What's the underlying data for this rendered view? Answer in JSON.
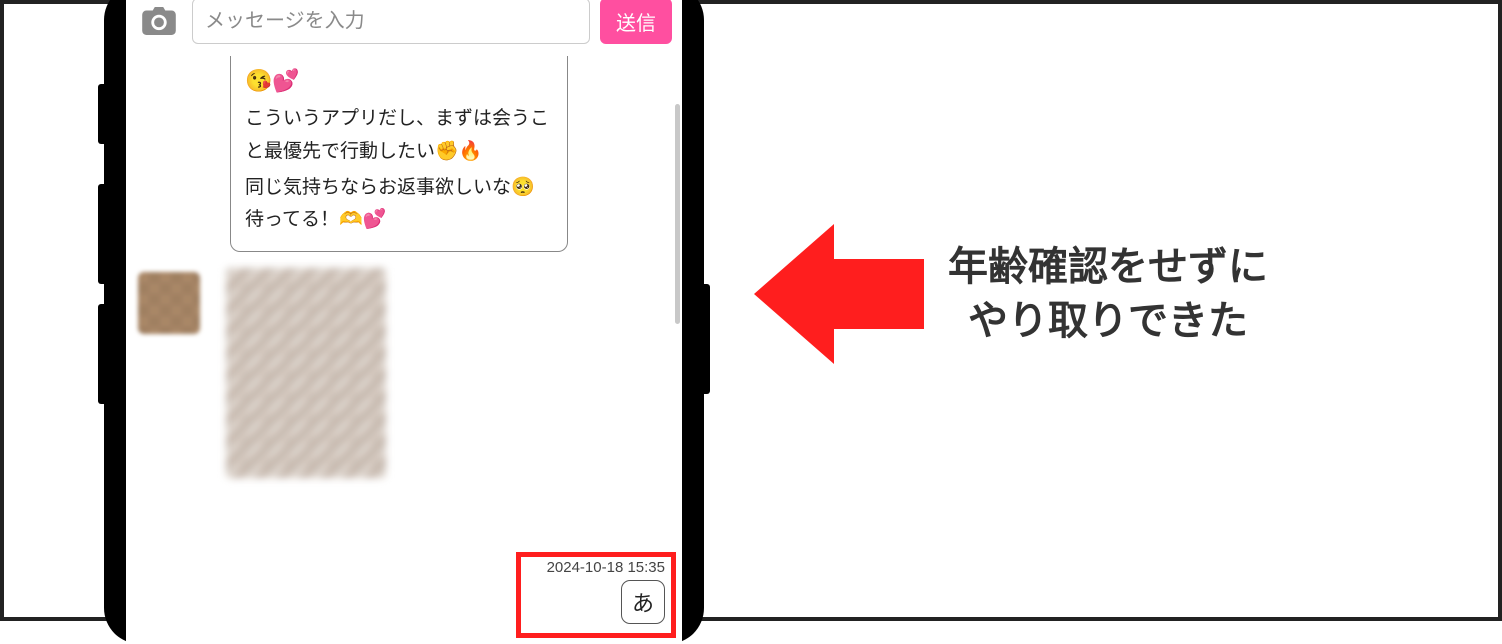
{
  "input": {
    "placeholder": "メッセージを入力",
    "send_label": "送信"
  },
  "message": {
    "emoji_line": "😘💕",
    "body_1": "こういうアプリだし、まずは会うこと最優先で行動したい✊🔥",
    "body_2": "同じ気持ちならお返事欲しいな🥺待ってる！🫶💕"
  },
  "reply": {
    "timestamp": "2024-10-18 15:35",
    "text": "あ"
  },
  "annotation": {
    "line1": "年齢確認をせずに",
    "line2": "やり取りできた"
  }
}
